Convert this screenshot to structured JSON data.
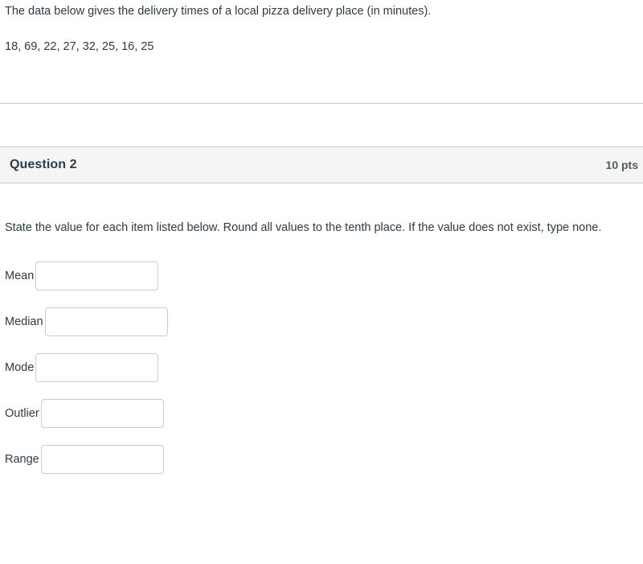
{
  "intro": {
    "description": "The data below gives the delivery times of a local pizza delivery place (in minutes).",
    "data_values": "18, 69, 22, 27, 32, 25, 16, 25"
  },
  "question": {
    "title": "Question 2",
    "points": "10 pts",
    "prompt": "State the value for each item listed below. Round all values to the tenth place.  If the value does not exist, type none."
  },
  "fields": [
    {
      "label": "Mean",
      "value": "",
      "placeholder": ""
    },
    {
      "label": "Median",
      "value": "",
      "placeholder": ""
    },
    {
      "label": "Mode",
      "value": "",
      "placeholder": ""
    },
    {
      "label": "Outlier",
      "value": "",
      "placeholder": ""
    },
    {
      "label": "Range",
      "value": "",
      "placeholder": ""
    }
  ],
  "colors": {
    "text": "#2d3b45",
    "header_background": "#f5f5f5",
    "border": "#c7cdd1",
    "page_background": "#ffffff"
  }
}
